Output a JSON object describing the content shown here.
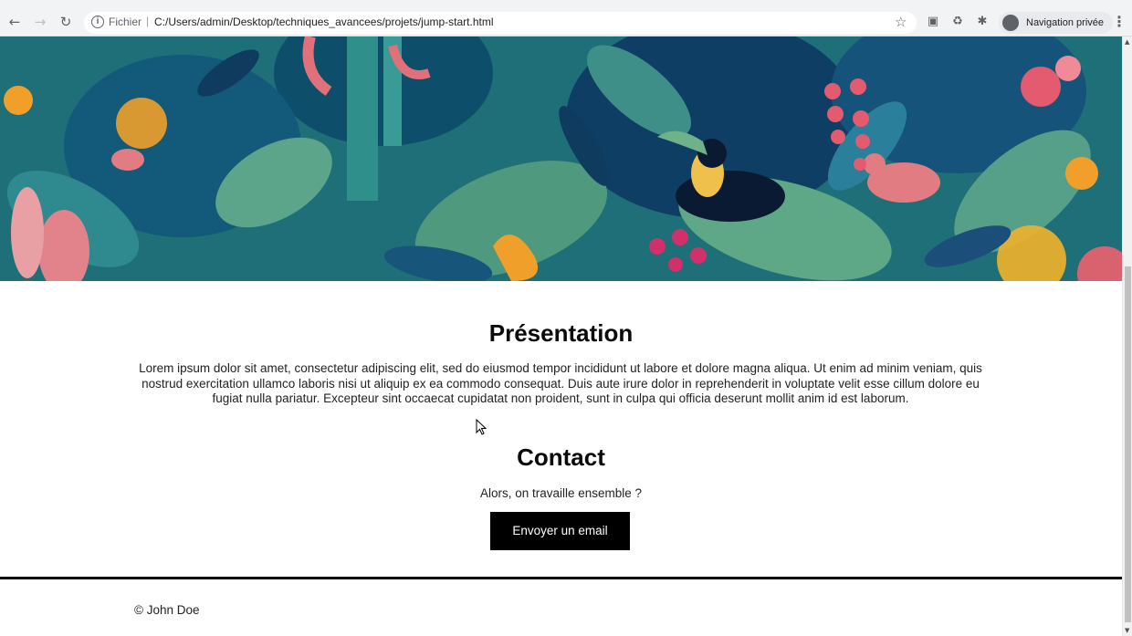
{
  "browser": {
    "scheme_label": "Fichier",
    "url": "C:/Users/admin/Desktop/techniques_avancees/projets/jump-start.html",
    "profile_label": "Navigation privée",
    "icons": [
      "back-icon",
      "forward-icon",
      "reload-icon",
      "info-icon",
      "star-icon",
      "camera-icon",
      "recycle-icon",
      "puzzle-icon",
      "incognito-icon",
      "kebab-icon"
    ]
  },
  "page": {
    "presentation": {
      "title": "Présentation",
      "body": "Lorem ipsum dolor sit amet, consectetur adipiscing elit, sed do eiusmod tempor incididunt ut labore et dolore magna aliqua. Ut enim ad minim veniam, quis nostrud exercitation ullamco laboris nisi ut aliquip ex ea commodo consequat. Duis aute irure dolor in reprehenderit in voluptate velit esse cillum dolore eu fugiat nulla pariatur. Excepteur sint occaecat cupidatat non proident, sunt in culpa qui officia deserunt mollit anim id est laborum."
    },
    "contact": {
      "title": "Contact",
      "subtitle": "Alors, on travaille ensemble ?",
      "button_label": "Envoyer un email"
    },
    "footer": {
      "copyright": "© John Doe"
    }
  },
  "colors": {
    "hero_base": "#1f6f78",
    "leaf_dark": "#0d4f6b",
    "leaf_green": "#5da58a",
    "pink": "#e0707a",
    "orange": "#f0a02a",
    "button_bg": "#000000"
  }
}
